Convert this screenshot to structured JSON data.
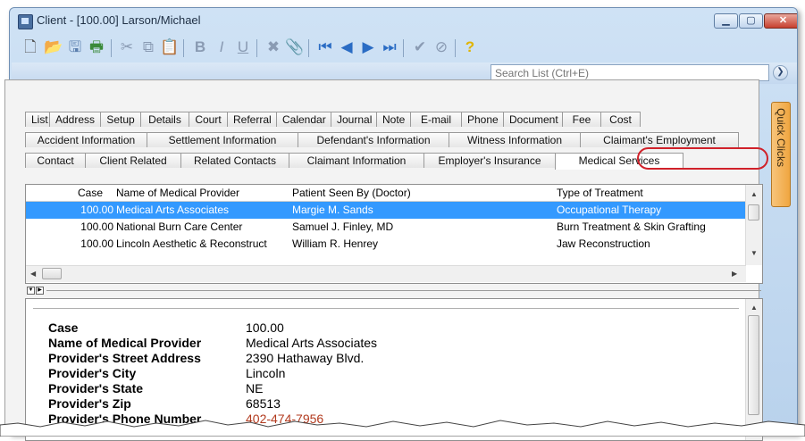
{
  "window": {
    "title": "Client - [100.00] Larson/Michael",
    "controls": {
      "minimize": "▁",
      "maximize": "▢",
      "close": "✕"
    }
  },
  "toolbar": {
    "icons": [
      "new-document-icon",
      "open-folder-icon",
      "save-icon",
      "print-icon",
      "cut-icon",
      "copy-icon",
      "paste-icon",
      "bold-icon",
      "italic-icon",
      "underline-icon",
      "delete-icon",
      "attach-icon",
      "first-record-icon",
      "previous-record-icon",
      "next-record-icon",
      "last-record-icon",
      "check-icon",
      "cancel-icon",
      "help-icon"
    ],
    "bold_label": "B",
    "italic_label": "I",
    "underline_label": "U"
  },
  "search": {
    "placeholder": "Search List (Ctrl+E)",
    "value": ""
  },
  "tabs": {
    "row1": [
      "List",
      "Address",
      "Setup",
      "Details",
      "Court",
      "Referral",
      "Calendar",
      "Journal",
      "Note",
      "E-mail",
      "Phone",
      "Document",
      "Fee",
      "Cost"
    ],
    "row2": [
      "Accident Information",
      "Settlement Information",
      "Defendant's Information",
      "Witness Information",
      "Claimant's Employment"
    ],
    "row3": [
      "Contact",
      "Client Related",
      "Related Contacts",
      "Claimant Information",
      "Employer's Insurance",
      "Medical Services"
    ],
    "active": "Medical Services"
  },
  "quick_clicks": "Quick Clicks",
  "grid": {
    "columns": [
      "Case",
      "Name of Medical Provider",
      "Patient Seen By (Doctor)",
      "Type of Treatment"
    ],
    "rows": [
      [
        "100.00",
        "Medical Arts Associates",
        "Margie M. Sands",
        "Occupational Therapy"
      ],
      [
        "100.00",
        "National Burn Care Center",
        "Samuel J. Finley, MD",
        "Burn Treatment & Skin Grafting"
      ],
      [
        "100.00",
        "Lincoln Aesthetic & Reconstruct",
        "William R. Henrey",
        "Jaw Reconstruction"
      ]
    ],
    "selected_row": 0
  },
  "detail": {
    "fields": [
      {
        "label": "Case",
        "value": "100.00"
      },
      {
        "label": "Name of Medical Provider",
        "value": "Medical Arts Associates"
      },
      {
        "label": "Provider's Street Address",
        "value": "2390 Hathaway Blvd."
      },
      {
        "label": "Provider's City",
        "value": "Lincoln"
      },
      {
        "label": "Provider's State",
        "value": "NE"
      },
      {
        "label": "Provider's Zip",
        "value": "68513"
      },
      {
        "label": "Provider's Phone Number",
        "value": "402-474-7956"
      }
    ]
  },
  "colors": {
    "selection": "#3399ff",
    "highlight_ring": "#d0212a",
    "quick_clicks": "#f0a640",
    "link": "#b23a1e"
  }
}
